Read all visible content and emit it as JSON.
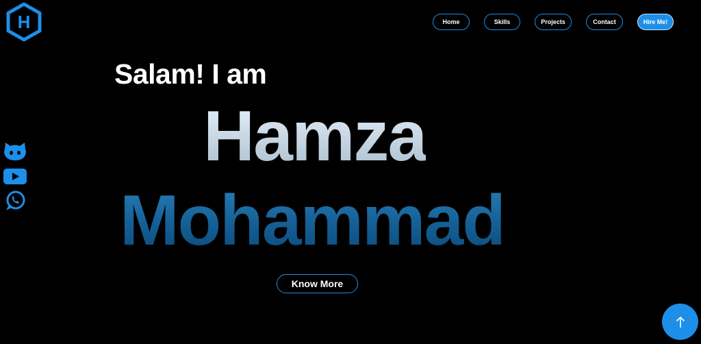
{
  "logo": {
    "letter": "H",
    "icon": "hexagon-logo-icon"
  },
  "nav": {
    "items": [
      {
        "label": "Home"
      },
      {
        "label": "Skills"
      },
      {
        "label": "Projects"
      },
      {
        "label": "Contact"
      }
    ],
    "cta_label": "Hire Me!"
  },
  "social": [
    {
      "icon": "github-icon"
    },
    {
      "icon": "youtube-icon"
    },
    {
      "icon": "whatsapp-icon"
    }
  ],
  "hero": {
    "greeting": "Salam! I am",
    "first_name": "Hamza",
    "last_name": "Mohammad",
    "cta_label": "Know More"
  },
  "scroll_top": {
    "icon": "arrow-up-icon"
  },
  "colors": {
    "accent": "#1d8fe8",
    "background": "#000000",
    "text": "#ffffff",
    "first_name_gradient": [
      "#edf4fa",
      "#a8bccb"
    ],
    "last_name_gradient": [
      "#2a7eb7",
      "#0b4877"
    ]
  }
}
